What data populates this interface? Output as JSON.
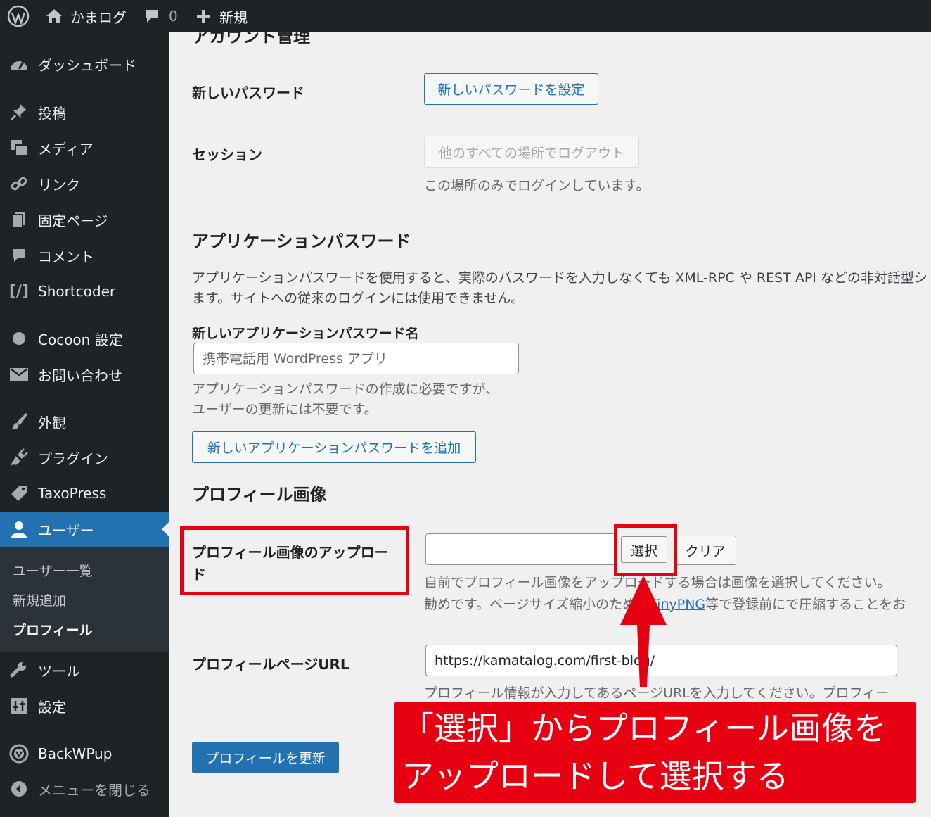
{
  "adminbar": {
    "site_name": "かまログ",
    "comments_count": "0",
    "new_label": "新規"
  },
  "sidebar": {
    "items": [
      {
        "label": "ダッシュボード",
        "icon": "dashboard-icon"
      },
      {
        "label": "投稿",
        "icon": "pin-icon"
      },
      {
        "label": "メディア",
        "icon": "media-icon"
      },
      {
        "label": "リンク",
        "icon": "link-icon"
      },
      {
        "label": "固定ページ",
        "icon": "page-icon"
      },
      {
        "label": "コメント",
        "icon": "comment-icon"
      },
      {
        "label": "Shortcoder",
        "icon": "shortcode-icon"
      },
      {
        "label": "Cocoon 設定",
        "icon": "circle-icon"
      },
      {
        "label": "お問い合わせ",
        "icon": "mail-icon"
      },
      {
        "label": "外観",
        "icon": "brush-icon"
      },
      {
        "label": "プラグイン",
        "icon": "plugin-icon"
      },
      {
        "label": "TaxoPress",
        "icon": "tag-icon"
      },
      {
        "label": "ユーザー",
        "icon": "user-icon"
      },
      {
        "label": "ツール",
        "icon": "wrench-icon"
      },
      {
        "label": "設定",
        "icon": "settings-icon"
      },
      {
        "label": "BackWPup",
        "icon": "backwpup-icon"
      },
      {
        "label": "メニューを閉じる",
        "icon": "collapse-icon"
      }
    ],
    "submenu": [
      "ユーザー一覧",
      "新規追加",
      "プロフィール"
    ]
  },
  "account": {
    "section_heading_partial": "アカウント管理",
    "new_password_label": "新しいパスワード",
    "new_password_button": "新しいパスワードを設定",
    "session_label": "セッション",
    "logout_button": "他のすべての場所でログアウト",
    "session_desc": "この場所のみでログインしています。"
  },
  "app_passwords": {
    "heading": "アプリケーションパスワード",
    "desc_line1": "アプリケーションパスワードを使用すると、実際のパスワードを入力しなくても XML-RPC や REST API などの非対話型シ",
    "desc_line2": "ます。サイトへの従来のログインには使用できません。",
    "name_label": "新しいアプリケーションパスワード名",
    "name_placeholder": "携帯電話用 WordPress アプリ",
    "name_desc_line1": "アプリケーションパスワードの作成に必要ですが、",
    "name_desc_line2": "ユーザーの更新には不要です。",
    "add_button": "新しいアプリケーションパスワードを追加"
  },
  "profile_image": {
    "heading": "プロフィール画像",
    "upload_label_line1": "プロフィール画像のアップロー",
    "upload_label_line2": "ド",
    "select_button": "選択",
    "clear_button": "クリア",
    "desc_line1": "自前でプロフィール画像をアップロードする場合は画像を選択してください。",
    "desc_line2_before": "勧めです。ページサイズ縮小のためは",
    "desc_link": "TinyPNG",
    "desc_line2_after": "等で登録前にで圧縮することをお",
    "page_url_label": "プロフィールページURL",
    "page_url_value": "https://kamatalog.com/first-blog/",
    "page_url_desc": "プロフィール情報が入力してあるページURLを入力してください。プロフィー"
  },
  "submit": {
    "update_button": "プロフィールを更新"
  },
  "annotation": {
    "line1": "「選択」からプロフィール画像を",
    "line2": "アップロードして選択する",
    "color": "#e60012"
  }
}
